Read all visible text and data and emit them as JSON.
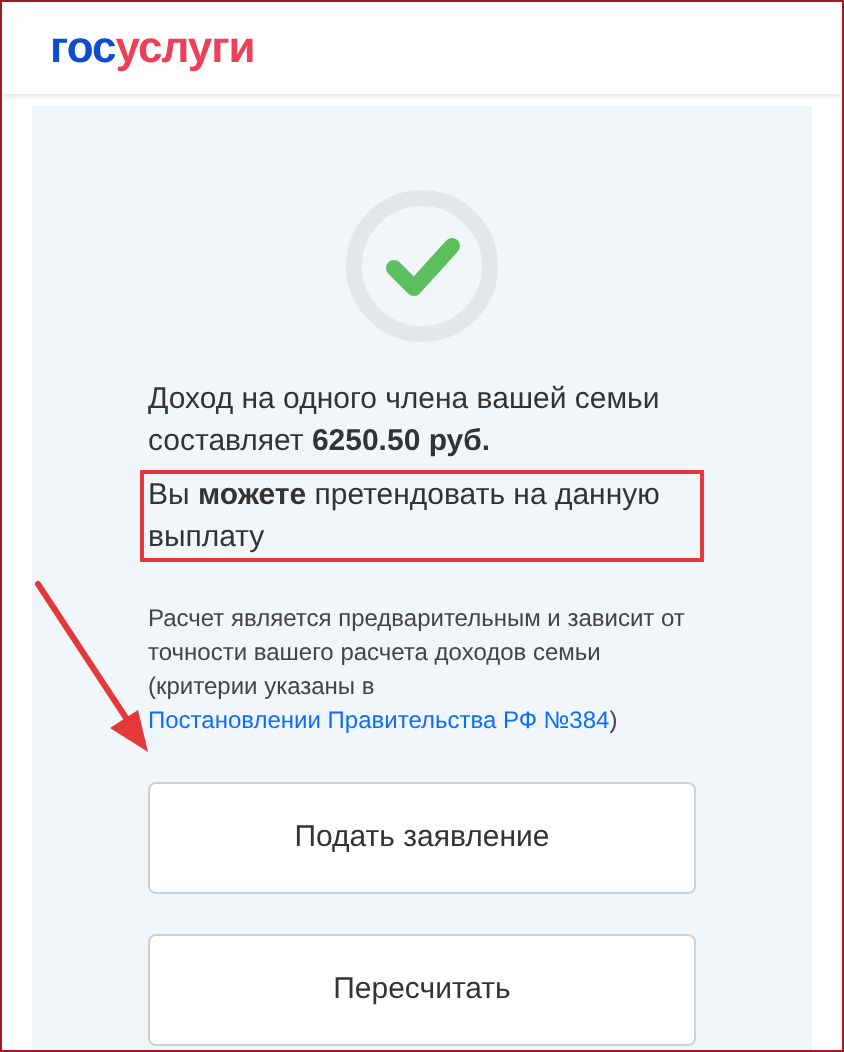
{
  "header": {
    "logo": {
      "first": "гос",
      "second": "услуги"
    }
  },
  "result": {
    "kind": "success",
    "income_text": "Доход на одного члена вашей семьи составляет **6250.50 руб.**",
    "eligibility_text": "Вы **можете** претендовать на данную выплату",
    "eligibility_highlighted": true,
    "note": {
      "text": "Расчет является предварительным и зависит от точности вашего расчета доходов семьи (критерии указаны в ",
      "link": "Постановлении Правительства РФ №384",
      "after": ")"
    }
  },
  "annotation_arrow": true,
  "buttons": [
    {
      "label": "Подать заявление"
    },
    {
      "label": "Пересчитать"
    }
  ]
}
